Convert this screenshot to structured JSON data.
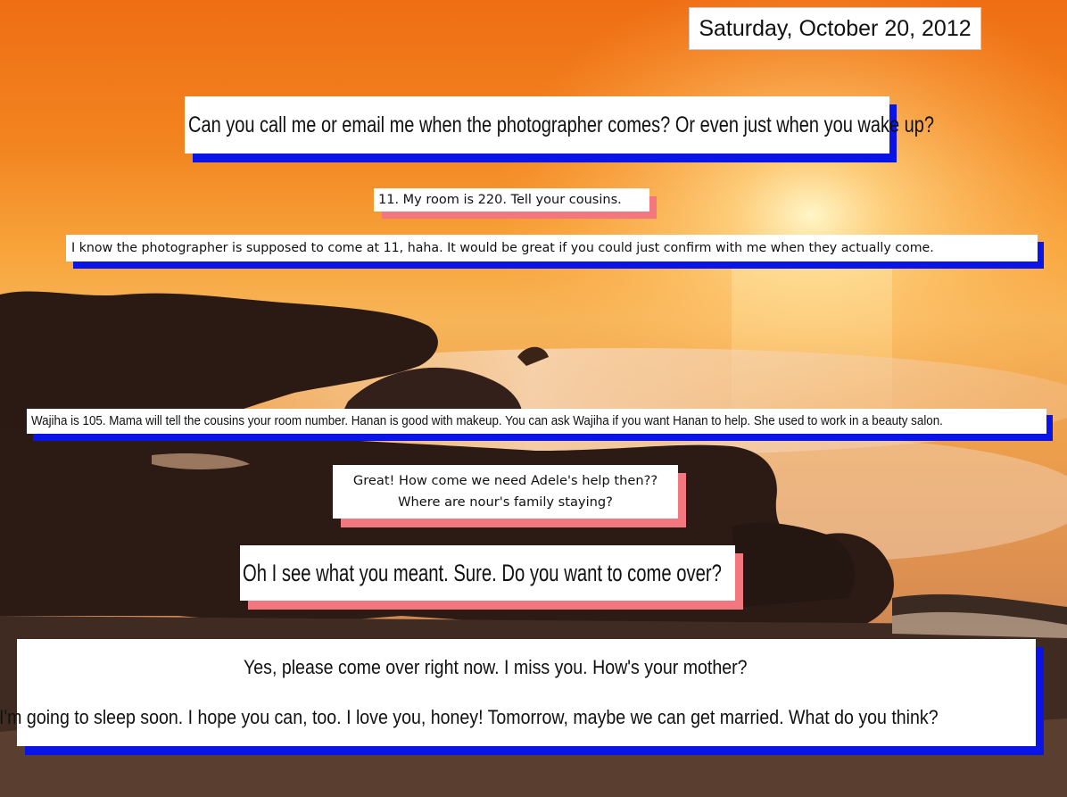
{
  "date_label": "Saturday, October 20, 2012",
  "colors": {
    "blue_shadow": "#0a14e6",
    "pink_shadow": "#f2777f",
    "sky_top": "#f0761a",
    "sun": "#fff0b0",
    "rock": "#2a1a14"
  },
  "messages": [
    {
      "text": "Can you call me or email me when the photographer comes? Or even just when you wake up?"
    },
    {
      "text": "11. My room is 220. Tell your cousins."
    },
    {
      "text": "I know the photographer is supposed to come at 11, haha. It would be great if you could just confirm with me when they actually come."
    },
    {
      "text": "Wajiha is 105. Mama will tell the cousins your room number. Hanan is good with makeup. You can ask Wajiha if you want Hanan to help. She used to work in a beauty salon."
    },
    {
      "lines": [
        "Great! How come we need Adele's help then??",
        "Where are nour's family staying?"
      ]
    },
    {
      "text": "Oh I see what you meant. Sure. Do you want to come over?"
    },
    {
      "lines": [
        "Yes, please come over right now. I miss you. How's your mother?",
        "I'm going to sleep soon. I hope you can, too. I love you, honey! Tomorrow, maybe we can get married. What do you think?"
      ]
    }
  ]
}
